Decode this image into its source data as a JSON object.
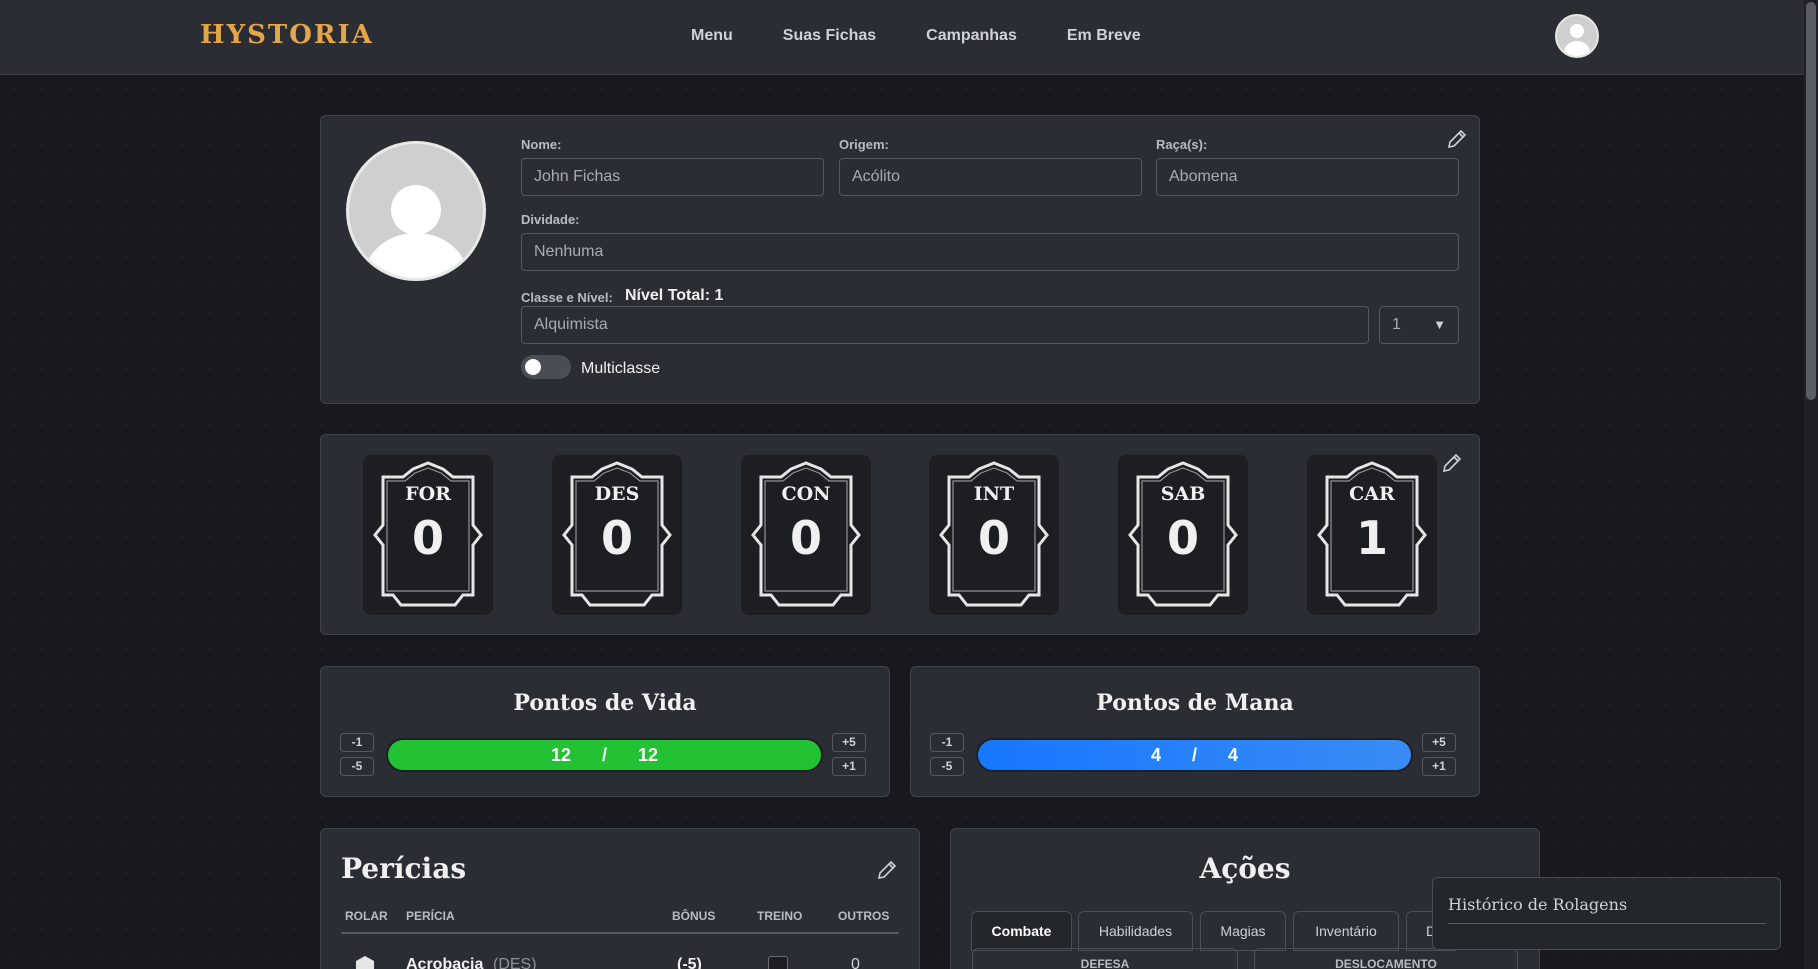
{
  "app": {
    "logo": "HYSTORIA"
  },
  "nav": {
    "items": [
      "Menu",
      "Suas Fichas",
      "Campanhas",
      "Em Breve"
    ]
  },
  "profile": {
    "nome_label": "Nome:",
    "nome_placeholder": "John Fichas",
    "origem_label": "Origem:",
    "origem_placeholder": "Acólito",
    "raca_label": "Raça(s):",
    "raca_placeholder": "Abomena",
    "divindade_label": "Dividade:",
    "divindade_placeholder": "Nenhuma",
    "classe_label": "Classe e Nível:",
    "nivel_total": "Nível Total: 1",
    "classe_placeholder": "Alquimista",
    "nivel_select": "1",
    "multiclasse_label": "Multiclasse"
  },
  "attributes": [
    {
      "abbr": "FOR",
      "value": "0"
    },
    {
      "abbr": "DES",
      "value": "0"
    },
    {
      "abbr": "CON",
      "value": "0"
    },
    {
      "abbr": "INT",
      "value": "0"
    },
    {
      "abbr": "SAB",
      "value": "0"
    },
    {
      "abbr": "CAR",
      "value": "1"
    }
  ],
  "vida": {
    "title": "Pontos de Vida",
    "current": "12",
    "sep": "/",
    "max": "12",
    "fill": 1.0
  },
  "mana": {
    "title": "Pontos de Mana",
    "current": "4",
    "sep": "/",
    "max": "4",
    "fill": 1.0
  },
  "adjust": {
    "minus1": "-1",
    "minus5": "-5",
    "plus5": "+5",
    "plus1": "+1"
  },
  "pericias": {
    "title": "Perícias",
    "headers": [
      "ROLAR",
      "PERÍCIA",
      "BÔNUS",
      "TREINO",
      "OUTROS"
    ],
    "rows": [
      {
        "name": "Acrobacia",
        "attr": "(DES)",
        "bonus": "(-5)",
        "outros": "0"
      }
    ]
  },
  "acoes": {
    "title": "Ações",
    "tabs": [
      "Combate",
      "Habilidades",
      "Magias",
      "Inventário",
      "D"
    ],
    "subheaders": [
      "DEFESA",
      "DESLOCAMENTO"
    ]
  },
  "historico": {
    "title": "Histórico de Rolagens"
  },
  "colors": {
    "hp": "#22c234",
    "mana": "#1a7fff",
    "logo": "#e5a64a"
  }
}
